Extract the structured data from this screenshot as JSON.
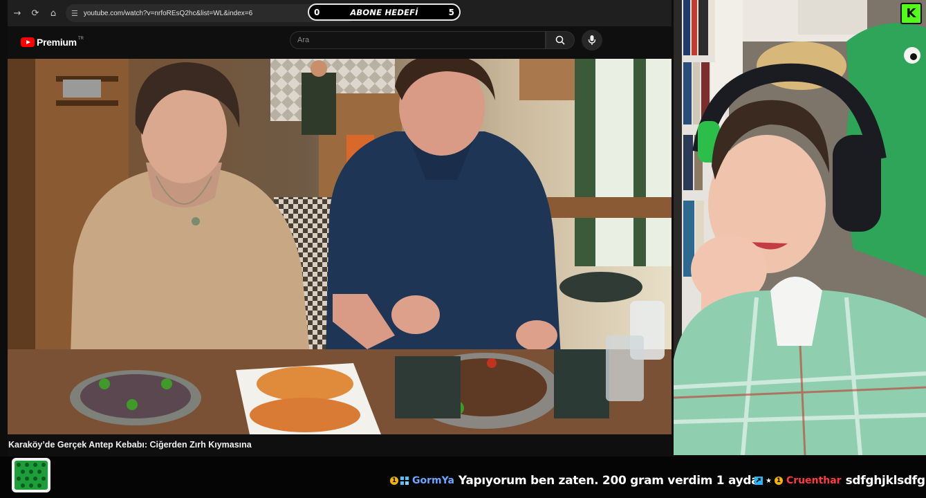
{
  "browser": {
    "url": "youtube.com/watch?v=nrfoREsQ2hc&list=WL&index=6",
    "icons": [
      "forward-icon",
      "reload-icon",
      "home-icon",
      "site-settings-icon"
    ]
  },
  "youtube": {
    "logo_text": "Premium",
    "logo_superscript": "TR",
    "search_placeholder": "Ara",
    "video_title": "Karaköy’de Gerçek Antep Kebabı: Ciğerden Zırh Kıymasına"
  },
  "goal": {
    "start": "0",
    "label": "ABONE HEDEFİ",
    "target": "5"
  },
  "chat": [
    {
      "user": "GormYa",
      "user_color": "#6aa7ff",
      "text": "Yapıyorum ben zaten. 200 gram verdim 1 ayda"
    },
    {
      "user": "Cruenthar",
      "user_color": "#ff3b3b",
      "text": "sdfghjklsdfg"
    }
  ],
  "colors": {
    "kick_green": "#53fc18",
    "youtube_red": "#ff0000",
    "sub_badge": "#f4b400"
  }
}
